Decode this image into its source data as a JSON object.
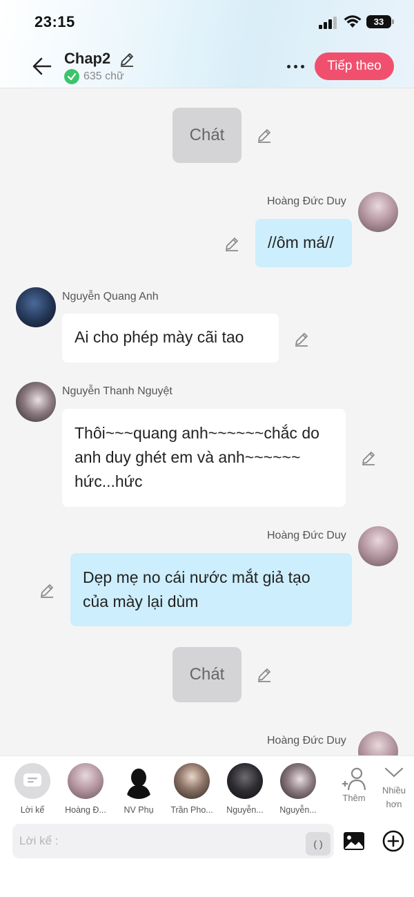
{
  "status_bar": {
    "time": "23:15",
    "battery": "33"
  },
  "header": {
    "title": "Chap2",
    "word_count": "635 chữ",
    "next_label": "Tiếp theo"
  },
  "messages": {
    "n1": "Chát",
    "s1": "Hoàng Đức Duy",
    "m1": "//ôm má//",
    "s2": "Nguyễn Quang Anh",
    "m2": "Ai cho phép mày cãi tao",
    "s3": "Nguyễn Thanh Nguyệt",
    "m3": "Thôi~~~quang anh~~~~~~chắc do anh duy ghét em và anh~~~~~~ hức...hức",
    "s4": "Hoàng Đức Duy",
    "m4": "Dẹp mẹ no cái nước mắt giả tạo của mày lại dùm",
    "n2": "Chát",
    "s5": "Hoàng Đức Duy"
  },
  "characters": [
    {
      "label": "Lời kể",
      "icon": "narration-icon"
    },
    {
      "label": "Hoàng Đ..."
    },
    {
      "label": "NV Phụ"
    },
    {
      "label": "Trần Pho..."
    },
    {
      "label": "Nguyễn..."
    },
    {
      "label": "Nguyễn..."
    }
  ],
  "tools": {
    "add_label": "Thêm",
    "more_label_1": "Nhiều",
    "more_label_2": "hơn"
  },
  "composer": {
    "placeholder": "Lời kể :",
    "paren": "( )"
  },
  "colors": {
    "accent": "#f0506e",
    "my_bubble": "#cdeefc",
    "check": "#3cc46b"
  }
}
